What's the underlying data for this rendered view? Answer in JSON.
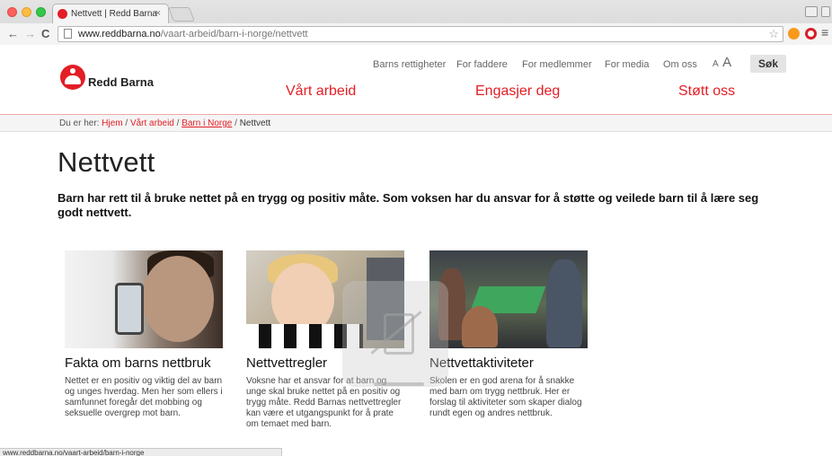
{
  "browser": {
    "tab_title": "Nettvett | Redd Barna",
    "tab_close": "×",
    "url_domain": "www.reddbarna.no",
    "url_path": "/vaart-arbeid/barn-i-norge/nettvett",
    "back_glyph": "←",
    "forward_glyph": "→",
    "reload_glyph": "C",
    "star_glyph": "☆",
    "menu_glyph": "≡",
    "status_url": "www.reddbarna.no/vaart-arbeid/barn-i-norge"
  },
  "header": {
    "logo_text": "Redd Barna",
    "util_nav": [
      "Barns rettigheter",
      "For faddere",
      "For medlemmer",
      "For media",
      "Om oss"
    ],
    "font_small": "A",
    "font_large": "A",
    "search_label": "Søk",
    "main_nav": [
      "Vårt arbeid",
      "Engasjer deg",
      "Støtt oss"
    ]
  },
  "breadcrumb": {
    "prefix": "Du er her: ",
    "items": [
      "Hjem",
      "Vårt arbeid",
      "Barn i Norge",
      "Nettvett"
    ],
    "sep": " / "
  },
  "page": {
    "title": "Nettvett",
    "lead": "Barn har rett til å bruke nettet på en trygg og positiv måte. Som voksen har du ansvar for å støtte og veilede barn til å lære seg godt nettvett."
  },
  "cards": [
    {
      "title": "Fakta om barns nettbruk",
      "text": "Nettet er en positiv og viktig del av barn og unges hverdag. Men her som ellers i samfunnet foregår det mobbing og seksuelle overgrep mot barn."
    },
    {
      "title": "Nettvettregler",
      "text": "Voksne har et ansvar for at barn og unge skal bruke nettet på en positiv og trygg måte. Redd Barnas nettvettregler kan være et utgangspunkt for å prate om temaet med barn."
    },
    {
      "title": "Nettvettaktiviteter",
      "text": "Skolen er en god arena for å snakke med barn om trygg nettbruk. Her er forslag til aktiviteter som skaper dialog rundt egen og andres nettbruk."
    }
  ],
  "colors": {
    "brand_red": "#e31e25"
  }
}
